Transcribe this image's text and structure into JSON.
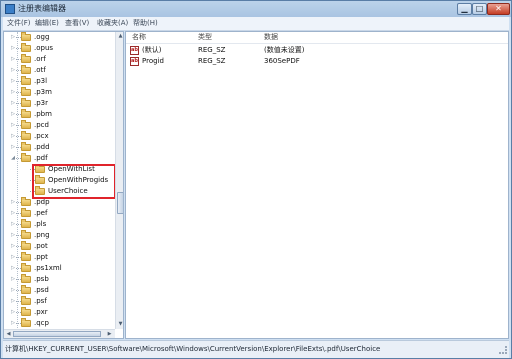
{
  "window": {
    "title": "注册表编辑器",
    "minimize_glyph": "▁",
    "maximize_glyph": "□",
    "close_glyph": "✕"
  },
  "menu": [
    "文件(F)",
    "编辑(E)",
    "查看(V)",
    "收藏夹(A)",
    "帮助(H)"
  ],
  "tree": {
    "items": [
      {
        "label": ".ogg",
        "state": "collapsed"
      },
      {
        "label": ".opus",
        "state": "collapsed"
      },
      {
        "label": ".orf",
        "state": "collapsed"
      },
      {
        "label": ".otf",
        "state": "collapsed"
      },
      {
        "label": ".p3l",
        "state": "collapsed"
      },
      {
        "label": ".p3m",
        "state": "collapsed"
      },
      {
        "label": ".p3r",
        "state": "collapsed"
      },
      {
        "label": ".pbm",
        "state": "collapsed"
      },
      {
        "label": ".pcd",
        "state": "collapsed"
      },
      {
        "label": ".pcx",
        "state": "collapsed"
      },
      {
        "label": ".pdd",
        "state": "collapsed"
      },
      {
        "label": ".pdf",
        "state": "expanded"
      },
      {
        "label": "OpenWithList",
        "state": "child"
      },
      {
        "label": "OpenWithProgids",
        "state": "child"
      },
      {
        "label": "UserChoice",
        "state": "child-selected"
      },
      {
        "label": ".pdp",
        "state": "collapsed"
      },
      {
        "label": ".pef",
        "state": "collapsed"
      },
      {
        "label": ".pls",
        "state": "collapsed"
      },
      {
        "label": ".png",
        "state": "collapsed"
      },
      {
        "label": ".pot",
        "state": "collapsed"
      },
      {
        "label": ".ppt",
        "state": "collapsed"
      },
      {
        "label": ".ps1xml",
        "state": "collapsed"
      },
      {
        "label": ".psb",
        "state": "collapsed"
      },
      {
        "label": ".psd",
        "state": "collapsed"
      },
      {
        "label": ".psf",
        "state": "collapsed"
      },
      {
        "label": ".pxr",
        "state": "collapsed"
      },
      {
        "label": ".qcp",
        "state": "collapsed"
      }
    ],
    "collapsed_glyph": "▷",
    "expanded_glyph": "◢",
    "scroll_up_glyph": "▲",
    "scroll_down_glyph": "▼",
    "scroll_left_glyph": "◀",
    "scroll_right_glyph": "▶",
    "highlight_color": "#e0242b"
  },
  "values": {
    "columns": {
      "name": "名称",
      "type": "类型",
      "data": "数据"
    },
    "rows": [
      {
        "name": "(默认)",
        "type": "REG_SZ",
        "data": "(数值未设置)",
        "icon": "ab"
      },
      {
        "name": "Progid",
        "type": "REG_SZ",
        "data": "360SePDF",
        "icon": "ab"
      }
    ]
  },
  "status": {
    "path": "计算机\\HKEY_CURRENT_USER\\Software\\Microsoft\\Windows\\CurrentVersion\\Explorer\\FileExts\\.pdf\\UserChoice"
  }
}
